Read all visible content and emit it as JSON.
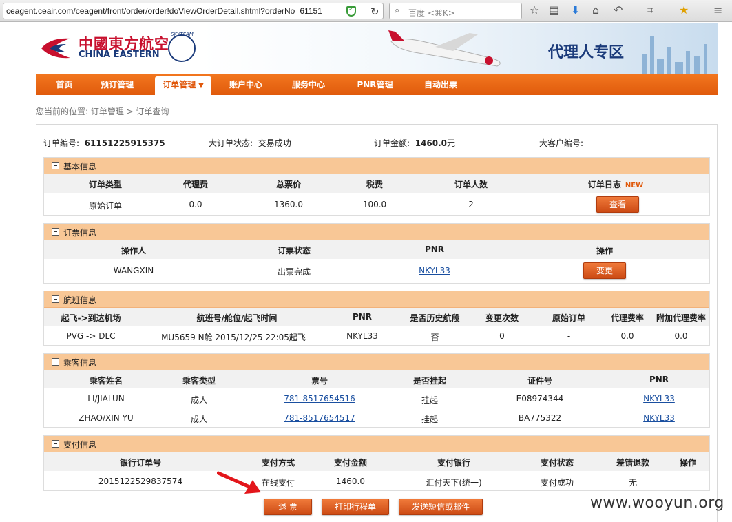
{
  "browser": {
    "url": "ceagent.ceair.com/ceagent/front/order/order!doViewOrderDetail.shtml?orderNo=61151",
    "search_placeholder": "百度 <⌘K>"
  },
  "header": {
    "logo_cn": "中國東方航空",
    "logo_en": "CHINA EASTERN",
    "skyteam": "SKYTEAM",
    "agent_zone": "代理人专区"
  },
  "nav": {
    "items": [
      {
        "label": "首页"
      },
      {
        "label": "预订管理"
      },
      {
        "label": "订单管理"
      },
      {
        "label": "账户中心"
      },
      {
        "label": "服务中心"
      },
      {
        "label": "PNR管理"
      },
      {
        "label": "自动出票"
      }
    ]
  },
  "breadcrumb": "您当前的位置: 订单管理 > 订单查询",
  "summary": {
    "order_no_label": "订单编号:",
    "order_no": "61151225915375",
    "status_label": "大订单状态:",
    "status": "交易成功",
    "amount_label": "订单金额:",
    "amount": "1460.0",
    "amount_unit": "元",
    "client_label": "大客户编号:"
  },
  "basic": {
    "title": "基本信息",
    "headers": [
      "订单类型",
      "代理费",
      "总票价",
      "税费",
      "订单人数",
      "订单日志"
    ],
    "new_badge": "NEW",
    "row": [
      "原始订单",
      "0.0",
      "1360.0",
      "100.0",
      "2"
    ],
    "view_button": "查看"
  },
  "ticketing": {
    "title": "订票信息",
    "headers": [
      "操作人",
      "订票状态",
      "PNR",
      "操作"
    ],
    "row": [
      "WANGXIN",
      "出票完成",
      "NKYL33"
    ],
    "change_button": "变更"
  },
  "flight": {
    "title": "航班信息",
    "headers": [
      "起飞->到达机场",
      "航班号/舱位/起飞时间",
      "PNR",
      "是否历史航段",
      "变更次数",
      "原始订单",
      "代理费率",
      "附加代理费率"
    ],
    "row": [
      "PVG -> DLC",
      "MU5659 N舱 2015/12/25 22:05起飞",
      "NKYL33",
      "否",
      "0",
      "-",
      "0.0",
      "0.0"
    ]
  },
  "passengers": {
    "title": "乘客信息",
    "headers": [
      "乘客姓名",
      "乘客类型",
      "票号",
      "是否挂起",
      "证件号",
      "PNR"
    ],
    "rows": [
      [
        "LI/JIALUN",
        "成人",
        "781-8517654516",
        "挂起",
        "E08974344",
        "NKYL33"
      ],
      [
        "ZHAO/XIN YU",
        "成人",
        "781-8517654517",
        "挂起",
        "BA775322",
        "NKYL33"
      ]
    ]
  },
  "payment": {
    "title": "支付信息",
    "headers": [
      "银行订单号",
      "支付方式",
      "支付金额",
      "支付银行",
      "支付状态",
      "差错退款",
      "操作"
    ],
    "row": [
      "2015122529837574",
      "在线支付",
      "1460.0",
      "汇付天下(统一)",
      "支付成功",
      "无"
    ]
  },
  "actions": {
    "refund": "退  票",
    "print": "打印行程单",
    "send": "发送短信或邮件"
  },
  "watermark": "www.wooyun.org",
  "colors": {
    "nav_orange": "#e8661a",
    "section_head": "#f8c796",
    "button_orange": "#d9551b",
    "link_blue": "#1a4fa0",
    "arrow_red": "#e3161b"
  }
}
